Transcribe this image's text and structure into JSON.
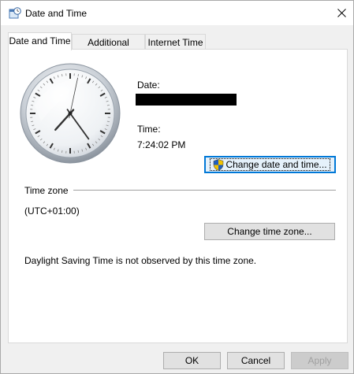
{
  "window": {
    "title": "Date and Time",
    "close_glyph": "✕"
  },
  "tabs": [
    {
      "label": "Date and Time",
      "active": true
    },
    {
      "label": "Additional Clocks",
      "active": false
    },
    {
      "label": "Internet Time",
      "active": false
    }
  ],
  "clock": {
    "hour": 7,
    "minute": 24,
    "second": 2
  },
  "date_section": {
    "date_label": "Date:",
    "date_value_redacted": true,
    "time_label": "Time:",
    "time_value": "7:24:02 PM"
  },
  "change_datetime_button": "Change date and time...",
  "timezone": {
    "section_label": "Time zone",
    "value": "(UTC+01:00)",
    "change_button": "Change time zone...",
    "dst_note": "Daylight Saving Time is not observed by this time zone."
  },
  "footer": {
    "ok": "OK",
    "cancel": "Cancel",
    "apply": "Apply"
  },
  "colors": {
    "focus_accent": "#0078d7",
    "shield_blue": "#1f5fbf",
    "shield_yellow": "#f2c200"
  }
}
